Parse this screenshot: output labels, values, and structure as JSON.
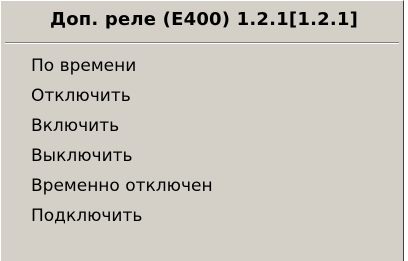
{
  "menu": {
    "title": "Доп. реле (E400) 1.2.1[1.2.1]",
    "items": [
      {
        "label": "По времени"
      },
      {
        "label": "Отключить"
      },
      {
        "label": "Включить"
      },
      {
        "label": "Выключить"
      },
      {
        "label": "Временно отключен"
      },
      {
        "label": "Подключить"
      }
    ]
  }
}
